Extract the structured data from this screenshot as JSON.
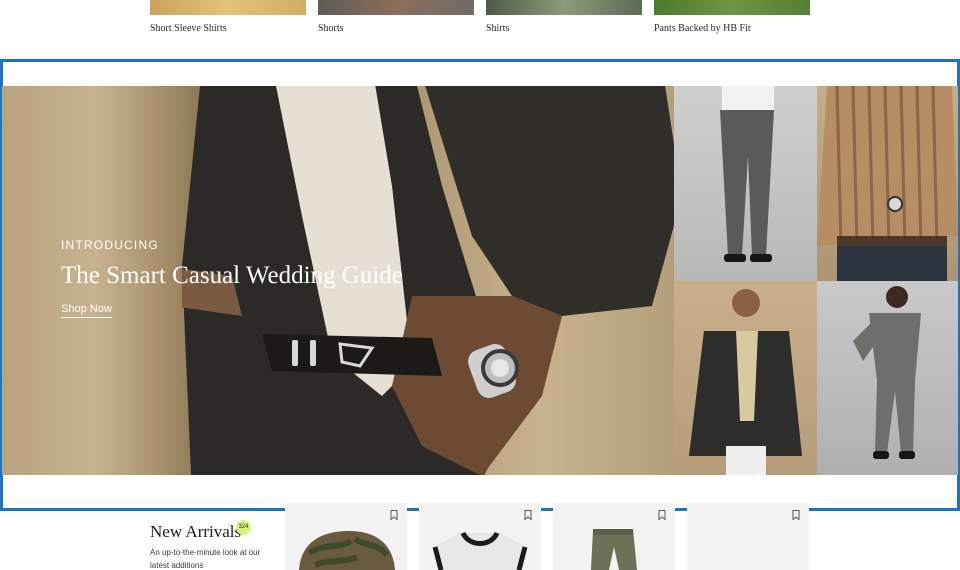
{
  "categories": [
    {
      "label": "Short Sleeve Shirts",
      "swatch": "#d9b466"
    },
    {
      "label": "Shorts",
      "swatch": "#7a776f"
    },
    {
      "label": "Shirts",
      "swatch": "#6f7a66"
    },
    {
      "label": "Pants Backed by HB Fit",
      "swatch": "#5f7f3c"
    }
  ],
  "hero": {
    "eyebrow": "INTRODUCING",
    "title": "The Smart Casual Wedding Guide",
    "cta": "Shop Now"
  },
  "new_arrivals": {
    "title": "New Arrivals",
    "count": "324",
    "description": "An up-to-the-minute look at our latest additions"
  },
  "icons": {
    "bookmark": "bookmark-icon"
  },
  "colors": {
    "selection_border": "#1a73c4",
    "badge": "#d7f27a"
  }
}
